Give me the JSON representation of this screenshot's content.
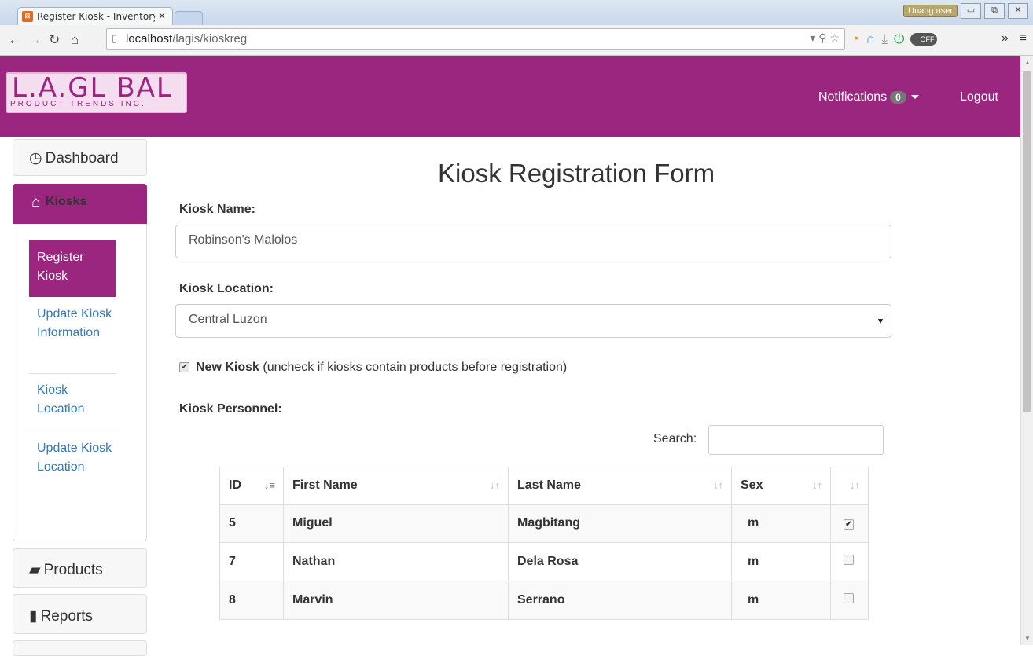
{
  "browser": {
    "tab_title": "Register Kiosk - Inventory",
    "tab_close": "×",
    "user_chip": "Unang user",
    "url_host": "localhost",
    "url_path": "/lagis/kioskreg",
    "toggle_label": "OFF"
  },
  "header": {
    "logo_main": "L.A.GL   BAL",
    "logo_sub": "PRODUCT TRENDS INC.",
    "notifications_label": "Notifications",
    "notifications_count": "0",
    "logout_label": "Logout"
  },
  "sidebar": {
    "dashboard": "Dashboard",
    "kiosks": "Kiosks",
    "sub_items": [
      "Register Kiosk",
      "Update Kiosk Information",
      "Kiosk Location",
      "Update Kiosk Location"
    ],
    "products": "Products",
    "reports": "Reports"
  },
  "form": {
    "title": "Kiosk Registration Form",
    "kiosk_name_label": "Kiosk Name:",
    "kiosk_name_value": "Robinson's Malolos",
    "kiosk_location_label": "Kiosk Location:",
    "kiosk_location_value": "Central Luzon",
    "new_kiosk_bold": "New Kiosk",
    "new_kiosk_note": "(uncheck if kiosks contain products before registration)",
    "new_kiosk_checked": true,
    "personnel_label": "Kiosk Personnel:",
    "search_label": "Search:"
  },
  "table": {
    "headers": [
      "ID",
      "First Name",
      "Last Name",
      "Sex",
      ""
    ],
    "rows": [
      {
        "id": "5",
        "first": "Miguel",
        "last": "Magbitang",
        "sex": "m",
        "checked": true
      },
      {
        "id": "7",
        "first": "Nathan",
        "last": "Dela Rosa",
        "sex": "m",
        "checked": false
      },
      {
        "id": "8",
        "first": "Marvin",
        "last": "Serrano",
        "sex": "m",
        "checked": false
      }
    ]
  },
  "colors": {
    "brand": "#9b2680",
    "link": "#337ab7"
  }
}
